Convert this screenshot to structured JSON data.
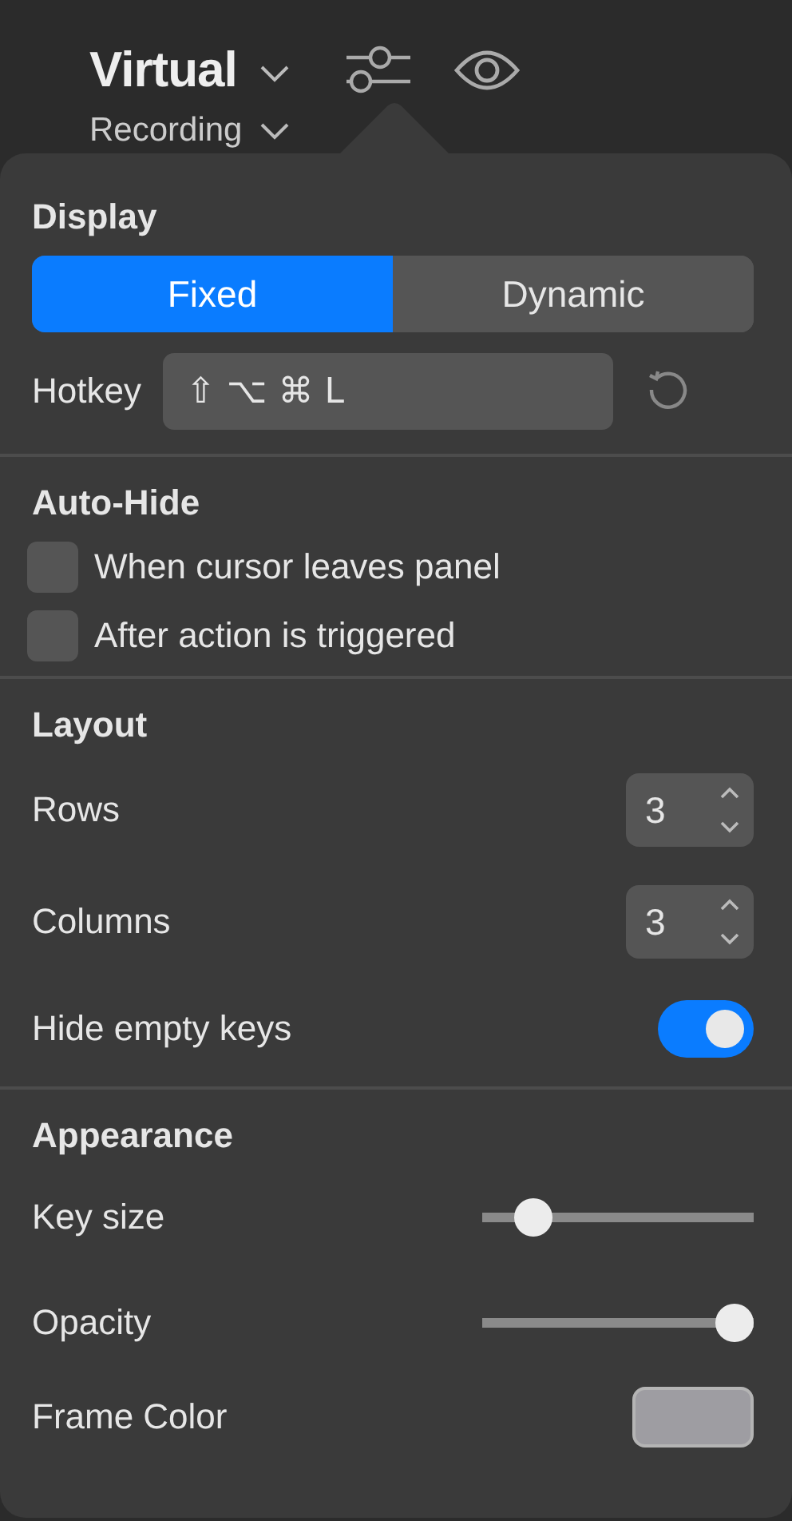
{
  "header": {
    "title": "Virtual",
    "subtitle": "Recording"
  },
  "sections": [
    {
      "title": "Display",
      "rows": [
        {
          "kind": "segmented",
          "options": [
            {
              "label": "Fixed",
              "selected": true
            },
            {
              "label": "Dynamic",
              "selected": false
            }
          ]
        },
        {
          "kind": "hotkey",
          "label": "Hotkey",
          "value": "⇧ ⌥ ⌘ L"
        }
      ]
    },
    {
      "title": "Auto-Hide",
      "rows": [
        {
          "kind": "checkbox",
          "label": "When cursor leaves panel",
          "checked": false
        },
        {
          "kind": "checkbox",
          "label": "After action is triggered",
          "checked": false
        }
      ]
    },
    {
      "title": "Layout",
      "rows": [
        {
          "kind": "stepper",
          "label": "Rows",
          "value": "3"
        },
        {
          "kind": "stepper",
          "label": "Columns",
          "value": "3"
        },
        {
          "kind": "toggle",
          "label": "Hide empty keys",
          "on": true
        }
      ]
    },
    {
      "title": "Appearance",
      "rows": [
        {
          "kind": "slider",
          "label": "Key size",
          "level": 0.14
        },
        {
          "kind": "slider",
          "label": "Opacity",
          "level": 1
        },
        {
          "kind": "color",
          "label": "Frame Color",
          "color": "#9e9da2"
        }
      ]
    }
  ]
}
